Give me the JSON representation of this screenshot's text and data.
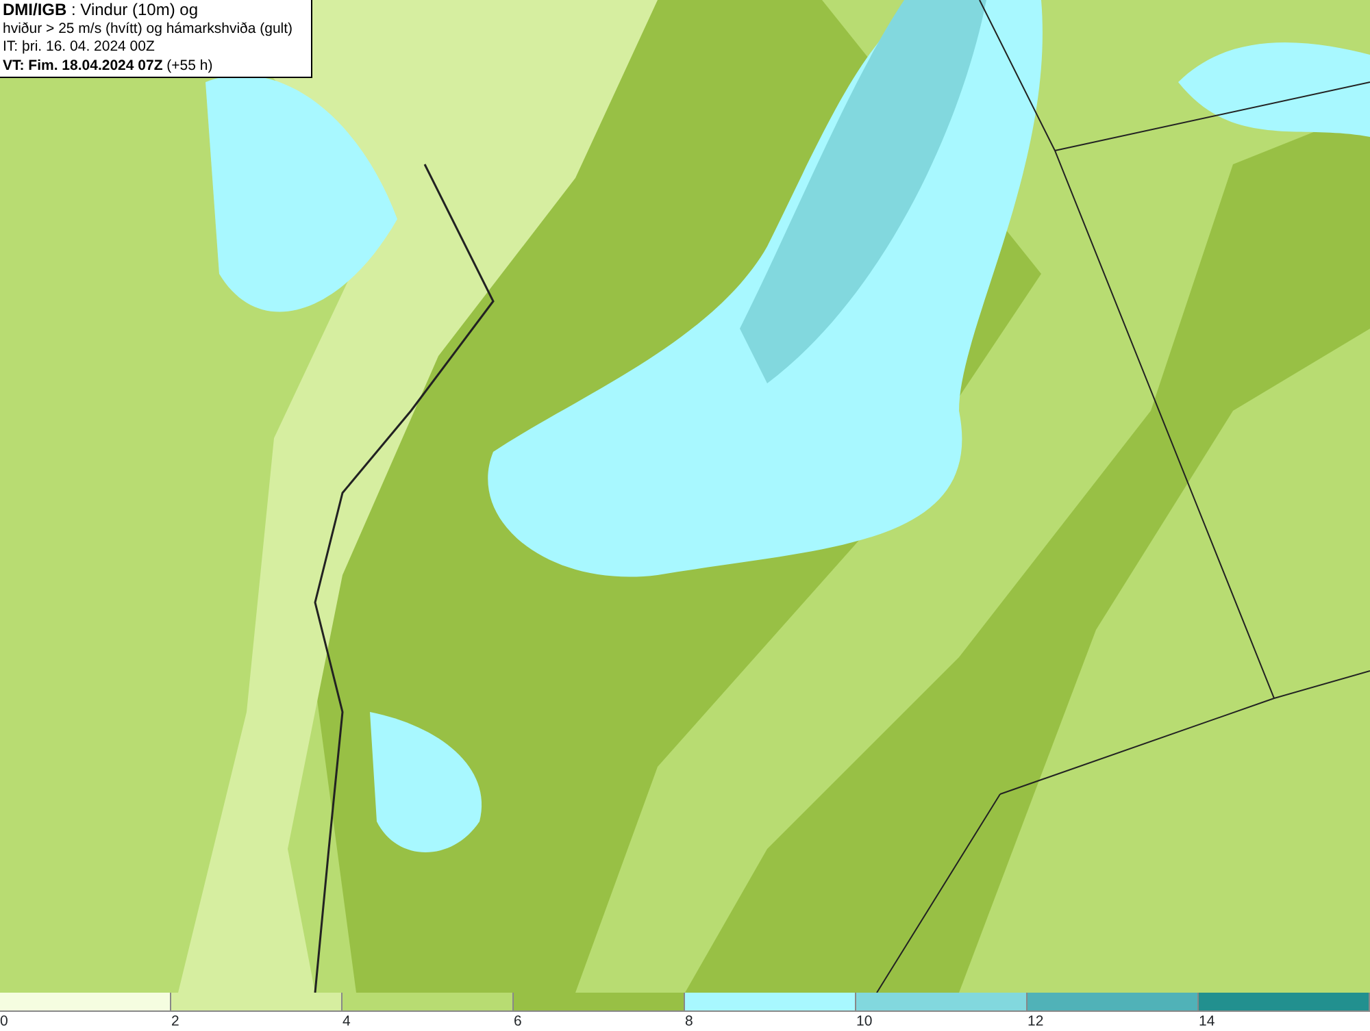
{
  "header": {
    "lines": [
      "**DMI/IGB** : Vindur (10m) og",
      "hviður > 25 m/s (hvítt) og hámarkshviða (gult)",
      "IT: þri. 16. 04. 2024 00Z",
      "**VT: Fim. 18.04.2024 07Z** (+55 h)"
    ]
  },
  "legend": [
    {
      "label": "0",
      "color": "#f5fde0"
    },
    {
      "label": "2",
      "color": "#d6eea0"
    },
    {
      "label": "4",
      "color": "#b8dc72"
    },
    {
      "label": "6",
      "color": "#98c045"
    },
    {
      "label": "8",
      "color": "#a8f8ff"
    },
    {
      "label": "10",
      "color": "#82d8de"
    },
    {
      "label": "12",
      "color": "#50b2b8"
    },
    {
      "label": "14",
      "color": "#22908f"
    }
  ]
}
